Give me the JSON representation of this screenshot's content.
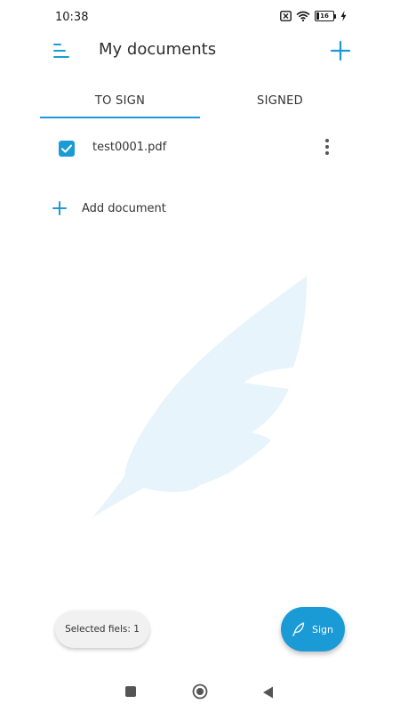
{
  "status_bar": {
    "time": "10:38",
    "battery": "16",
    "icons": [
      "sim-off-icon",
      "wifi-icon",
      "battery-icon",
      "charging-icon"
    ]
  },
  "app_bar": {
    "title": "My documents",
    "menu_icon": "menu-icon",
    "add_icon": "plus-icon"
  },
  "tabs": [
    {
      "label": "TO SIGN",
      "selected": true
    },
    {
      "label": "SIGNED",
      "selected": false
    }
  ],
  "documents": [
    {
      "name": "test0001.pdf",
      "checked": true
    }
  ],
  "add_document": {
    "label": "Add document"
  },
  "selection": {
    "text": "Selected fiels: 1"
  },
  "sign_button": {
    "label": "Sign",
    "icon": "feather-icon"
  },
  "nav": {
    "items": [
      "recents-square-icon",
      "home-circle-icon",
      "back-triangle-icon"
    ]
  },
  "colors": {
    "accent": "#1b9bd6",
    "watermark": "#e8f4fb"
  }
}
